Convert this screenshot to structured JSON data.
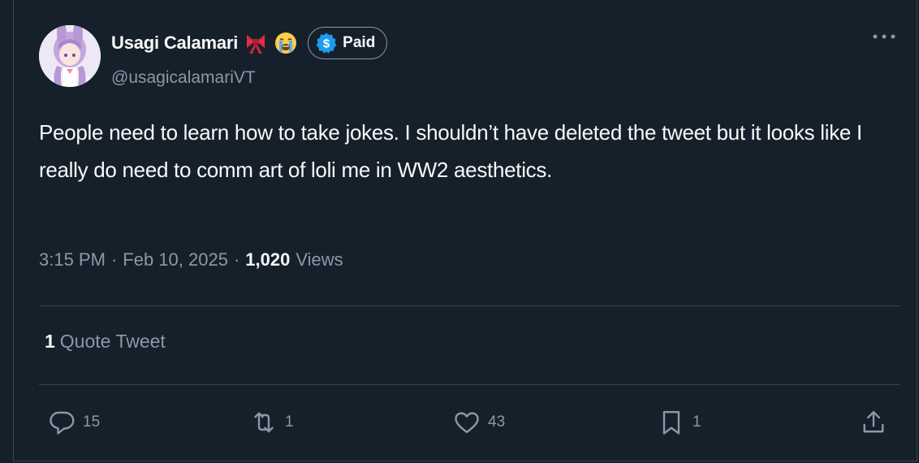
{
  "author": {
    "display_name": "Usagi Calamari",
    "emojis": [
      "ribbon-emoji",
      "loudly-crying-emoji"
    ],
    "badge_label": "Paid",
    "handle": "@usagicalamariVT"
  },
  "tweet": {
    "text": "People need to learn how to take jokes. I shouldn’t have deleted the tweet but it looks like I really do need to comm art of loli me in WW2 aesthetics."
  },
  "meta": {
    "time": "3:15 PM",
    "date": "Feb 10, 2025",
    "separator": "·",
    "views_count": "1,020",
    "views_label": "Views"
  },
  "quotes": {
    "count": "1",
    "label": "Quote Tweet"
  },
  "actions": {
    "reply_count": "15",
    "retweet_count": "1",
    "like_count": "43",
    "bookmark_count": "1"
  },
  "icons": {
    "reply": "reply-icon",
    "retweet": "retweet-icon",
    "like": "heart-icon",
    "bookmark": "bookmark-icon",
    "share": "share-icon",
    "more": "more-icon",
    "badge": "dollar-icon"
  },
  "colors": {
    "background": "#15202b",
    "border": "#38444d",
    "text_primary": "#f7f9f9",
    "text_secondary": "#8b98a5",
    "badge_blue": "#1d9bf0"
  }
}
